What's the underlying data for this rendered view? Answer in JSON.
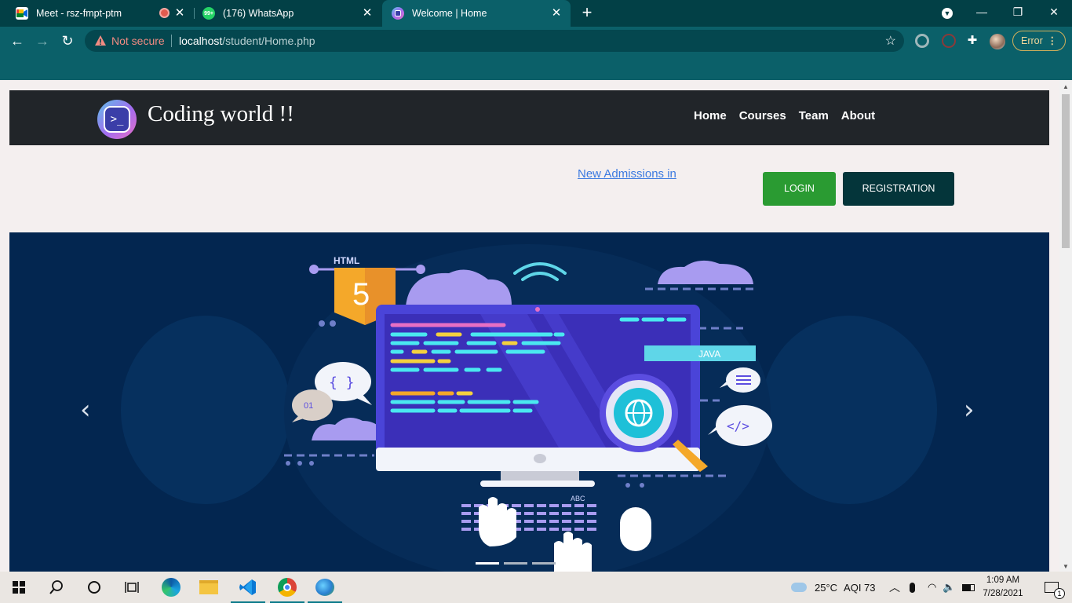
{
  "browser": {
    "tabs": [
      {
        "title": "Meet - rsz-fmpt-ptm",
        "icon": "google-meet-icon",
        "close": "✕"
      },
      {
        "title": "(176) WhatsApp",
        "icon": "whatsapp-icon",
        "close": "✕"
      },
      {
        "title": "Welcome | Home",
        "icon": "site-favicon-icon",
        "close": "✕",
        "active": true
      }
    ],
    "new_tab": "+",
    "security_label": "Not secure",
    "url_host": "localhost",
    "url_path": "/student/Home.php",
    "error_button": "Error"
  },
  "site": {
    "brand": "Coding world !!",
    "nav": [
      "Home",
      "Courses",
      "Team",
      "About"
    ],
    "marquee": "New Admissions in",
    "login_label": "LOGIN",
    "register_label": "REGISTRATION",
    "carousel": {
      "prev": "‹",
      "next": "›",
      "slide_count": 3,
      "active_index": 0,
      "graphic": {
        "html_label": "HTML",
        "html_number": "5",
        "java_label": "JAVA",
        "braces": "{ }",
        "binary": "01",
        "tag": "</>",
        "keyboard_label": "ABC"
      }
    }
  },
  "taskbar": {
    "weather_temp": "25°C",
    "aqi": "AQI 73",
    "time": "1:09 AM",
    "date": "7/28/2021",
    "notifications": "1"
  },
  "colors": {
    "tabbar": "#024046",
    "toolbar": "#0b6069",
    "navbar": "#212529",
    "login": "#2a9b32",
    "register": "#04353a",
    "carousel_bg": "#032650"
  }
}
